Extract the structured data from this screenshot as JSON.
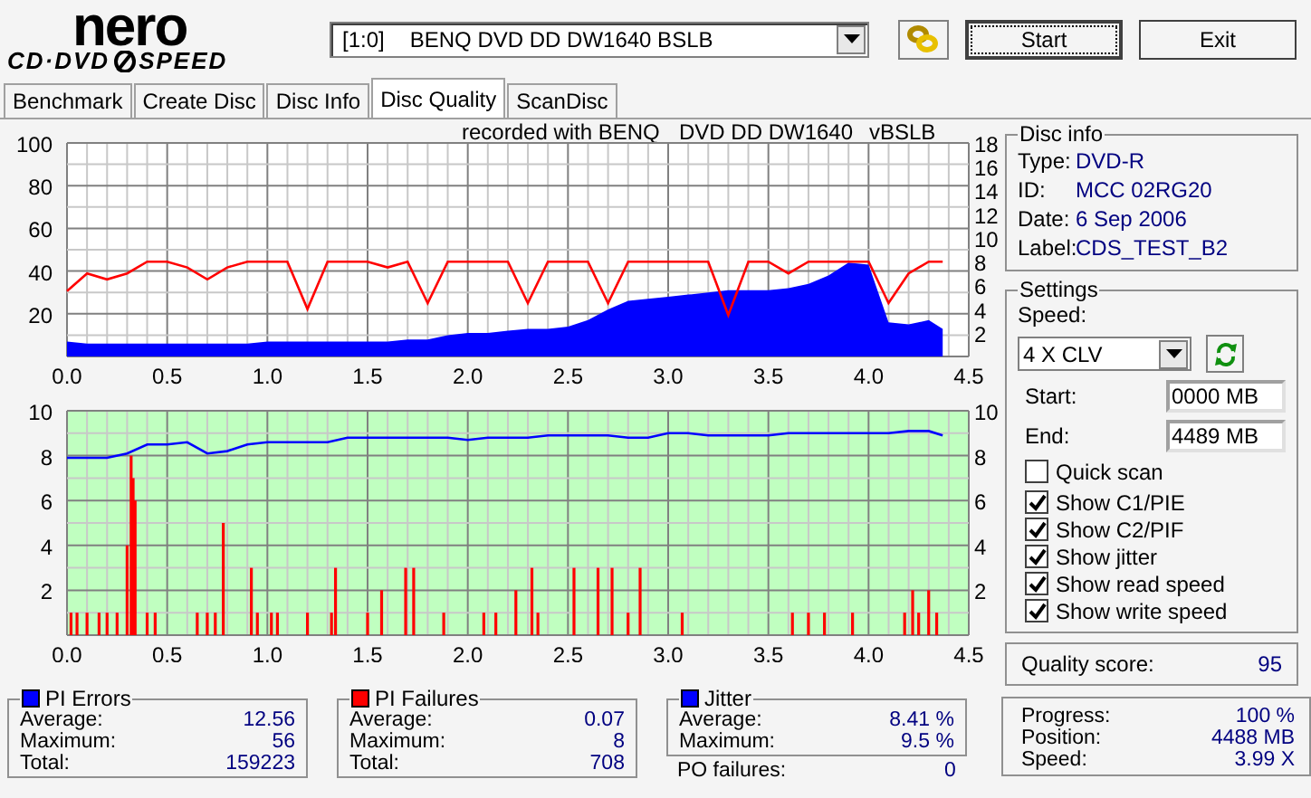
{
  "logo": {
    "brand": "nero",
    "product": [
      "CD·DVD",
      "SPEED"
    ]
  },
  "drive": {
    "port": "[1:0]",
    "name": "BENQ DVD DD DW1640 BSLB"
  },
  "buttons": [
    "Start",
    "Exit"
  ],
  "tabs": [
    {
      "label": "Benchmark",
      "selected": false
    },
    {
      "label": "Create Disc",
      "selected": false
    },
    {
      "label": "Disc Info",
      "selected": false
    },
    {
      "label": "Disc Quality",
      "selected": true
    },
    {
      "label": "ScanDisc",
      "selected": false
    }
  ],
  "recorded_with": [
    "recorded with BENQ",
    "DVD DD DW1640",
    "vBSLB"
  ],
  "charts": [
    {
      "chart_data": {
        "type": "area",
        "grid": true,
        "xlim": [
          0,
          4.5
        ],
        "ylim": [
          0,
          100
        ],
        "y2lim": [
          0,
          18
        ],
        "xticks": [
          {
            "value": 0,
            "label": "0.0"
          },
          {
            "value": 0.5,
            "label": "0.5"
          },
          {
            "value": 1,
            "label": "1.0"
          },
          {
            "value": 1.5,
            "label": "1.5"
          },
          {
            "value": 2,
            "label": "2.0"
          },
          {
            "value": 2.5,
            "label": "2.5"
          },
          {
            "value": 3,
            "label": "3.0"
          },
          {
            "value": 3.5,
            "label": "3.5"
          },
          {
            "value": 4,
            "label": "4.0"
          },
          {
            "value": 4.5,
            "label": "4.5"
          }
        ],
        "yticks": [
          20,
          40,
          60,
          80,
          100
        ],
        "y2ticks": [
          2,
          4,
          6,
          8,
          10,
          12,
          14,
          16,
          18
        ],
        "series": [
          {
            "color": "#0000ff",
            "x": [
              0,
              0.1,
              0.2,
              0.3,
              0.4,
              0.5,
              0.6,
              0.7,
              0.8,
              0.9,
              1,
              1.1,
              1.2,
              1.3,
              1.4,
              1.5,
              1.6,
              1.7,
              1.8,
              1.9,
              2,
              2.1,
              2.2,
              2.3,
              2.4,
              2.5,
              2.6,
              2.7,
              2.8,
              2.9,
              3,
              3.1,
              3.2,
              3.3,
              3.4,
              3.5,
              3.6,
              3.7,
              3.8,
              3.9,
              4,
              4.1,
              4.2,
              4.3,
              4.37
            ],
            "values": [
              7,
              6,
              6,
              6,
              6,
              6,
              6,
              6,
              6,
              6,
              7,
              7,
              7,
              7,
              7,
              7,
              7,
              8,
              8,
              10,
              11,
              11,
              12,
              13,
              13,
              14,
              17,
              22,
              26,
              27,
              28,
              29,
              30,
              31,
              31,
              31,
              32,
              34,
              38,
              44,
              43,
              16,
              15,
              17,
              13
            ]
          },
          {
            "type": "line",
            "axis": "y2",
            "color": "#ff0000",
            "x": [
              0,
              0.1,
              0.2,
              0.3,
              0.4,
              0.5,
              0.6,
              0.7,
              0.8,
              0.9,
              1,
              1.1,
              1.2,
              1.3,
              1.4,
              1.5,
              1.6,
              1.7,
              1.8,
              1.9,
              2,
              2.1,
              2.2,
              2.3,
              2.4,
              2.5,
              2.6,
              2.7,
              2.8,
              2.9,
              3,
              3.1,
              3.2,
              3.3,
              3.4,
              3.5,
              3.6,
              3.7,
              3.8,
              3.9,
              4,
              4.1,
              4.2,
              4.3,
              4.37
            ],
            "values": [
              5.5,
              7,
              6.5,
              7,
              8,
              8,
              7.5,
              6.5,
              7.5,
              8,
              8,
              8,
              4,
              8,
              8,
              8,
              7.5,
              8,
              4.5,
              8,
              8,
              8,
              8,
              4.5,
              8,
              8,
              8,
              4.5,
              8,
              8,
              8,
              8,
              8,
              3.5,
              8,
              8,
              7,
              8,
              8,
              8,
              8,
              4.5,
              7,
              8,
              8
            ]
          }
        ]
      }
    },
    {
      "chart_data": {
        "type": "bar",
        "grid": true,
        "xlim": [
          0,
          4.5
        ],
        "ylim": [
          0,
          10
        ],
        "y2lim": [
          0,
          10
        ],
        "xticks": [
          {
            "value": 0,
            "label": "0.0"
          },
          {
            "value": 0.5,
            "label": "0.5"
          },
          {
            "value": 1,
            "label": "1.0"
          },
          {
            "value": 1.5,
            "label": "1.5"
          },
          {
            "value": 2,
            "label": "2.0"
          },
          {
            "value": 2.5,
            "label": "2.5"
          },
          {
            "value": 3,
            "label": "3.0"
          },
          {
            "value": 3.5,
            "label": "3.5"
          },
          {
            "value": 4,
            "label": "4.0"
          },
          {
            "value": 4.5,
            "label": "4.5"
          }
        ],
        "yticks": [
          2,
          4,
          6,
          8,
          10
        ],
        "y2ticks": [
          2,
          4,
          6,
          8,
          10
        ],
        "series": [
          {
            "color": "#ff0000",
            "x": [
              0.02,
              0.05,
              0.1,
              0.16,
              0.2,
              0.25,
              0.3,
              0.32,
              0.33,
              0.34,
              0.4,
              0.44,
              0.65,
              0.7,
              0.74,
              0.78,
              0.92,
              0.95,
              1.02,
              1.05,
              1.2,
              1.32,
              1.34,
              1.5,
              1.57,
              1.69,
              1.73,
              1.88,
              2.08,
              2.14,
              2.24,
              2.32,
              2.35,
              2.53,
              2.65,
              2.72,
              2.8,
              2.86,
              3.07,
              3.62,
              3.7,
              3.78,
              3.92,
              4.18,
              4.22,
              4.25,
              4.3,
              4.34
            ],
            "values": [
              1,
              1,
              1,
              1,
              1,
              1,
              4,
              8,
              7,
              6,
              1,
              1,
              1,
              1,
              1,
              5,
              3,
              1,
              1,
              1,
              1,
              1,
              3,
              1,
              2,
              3,
              3,
              1,
              1,
              1,
              2,
              3,
              1,
              3,
              3,
              3,
              1,
              3,
              1,
              1,
              1,
              1,
              1,
              1,
              2,
              1,
              2,
              1
            ]
          },
          {
            "type": "line",
            "axis": "y2",
            "color": "#0000ff",
            "x": [
              0,
              0.1,
              0.2,
              0.3,
              0.4,
              0.5,
              0.6,
              0.7,
              0.8,
              0.9,
              1,
              1.1,
              1.2,
              1.3,
              1.4,
              1.5,
              1.6,
              1.7,
              1.8,
              1.9,
              2,
              2.1,
              2.2,
              2.3,
              2.4,
              2.5,
              2.6,
              2.7,
              2.8,
              2.9,
              3,
              3.1,
              3.2,
              3.3,
              3.4,
              3.5,
              3.6,
              3.7,
              3.8,
              3.9,
              4,
              4.1,
              4.2,
              4.3,
              4.37
            ],
            "values": [
              7.9,
              7.9,
              7.9,
              8.1,
              8.5,
              8.5,
              8.6,
              8.1,
              8.2,
              8.5,
              8.6,
              8.6,
              8.6,
              8.6,
              8.8,
              8.8,
              8.8,
              8.8,
              8.8,
              8.8,
              8.7,
              8.8,
              8.8,
              8.8,
              8.9,
              8.9,
              8.9,
              8.9,
              8.8,
              8.8,
              9,
              9,
              8.9,
              8.9,
              8.9,
              8.9,
              9,
              9,
              9,
              9,
              9,
              9,
              9.1,
              9.1,
              8.9
            ]
          }
        ]
      }
    }
  ],
  "disc_info": {
    "title": "Disc info",
    "rows": [
      {
        "label": "Type:",
        "value": "DVD-R"
      },
      {
        "label": "ID:",
        "value": "MCC 02RG20"
      },
      {
        "label": "Date:",
        "value": "6 Sep 2006"
      },
      {
        "label": "Label:",
        "value": "CDS_TEST_B2"
      }
    ]
  },
  "settings": {
    "title": "Settings",
    "speed_label": "Speed:",
    "speed": "4 X CLV",
    "fields": [
      {
        "label": "Start:",
        "value": "0000 MB"
      },
      {
        "label": "End:",
        "value": "4489 MB"
      }
    ],
    "checkboxes": [
      {
        "label": "Quick scan",
        "checked": false
      },
      {
        "label": "Show C1/PIE",
        "checked": true
      },
      {
        "label": "Show C2/PIF",
        "checked": true
      },
      {
        "label": "Show jitter",
        "checked": true
      },
      {
        "label": "Show read speed",
        "checked": true
      },
      {
        "label": "Show write speed",
        "checked": true
      }
    ]
  },
  "quality": {
    "label": "Quality score:",
    "value": "95"
  },
  "stats": [
    {
      "title": "PI Errors",
      "color": "#0000ff",
      "rows": [
        {
          "label": "Average:",
          "value": "12.56"
        },
        {
          "label": "Maximum:",
          "value": "56"
        },
        {
          "label": "Total:",
          "value": "159223"
        }
      ]
    },
    {
      "title": "PI Failures",
      "color": "#ff0000",
      "rows": [
        {
          "label": "Average:",
          "value": "0.07"
        },
        {
          "label": "Maximum:",
          "value": "8"
        },
        {
          "label": "Total:",
          "value": "708"
        }
      ]
    },
    {
      "title": "Jitter",
      "color": "#0000ff",
      "rows": [
        {
          "label": "Average:",
          "value": "8.41 %"
        },
        {
          "label": "Maximum:",
          "value": "9.5 %"
        }
      ]
    }
  ],
  "po_failures": {
    "label": "PO failures:",
    "value": "0"
  },
  "progress": [
    {
      "label": "Progress:",
      "value": "100 %"
    },
    {
      "label": "Position:",
      "value": "4488 MB"
    },
    {
      "label": "Speed:",
      "value": "3.99 X"
    }
  ]
}
